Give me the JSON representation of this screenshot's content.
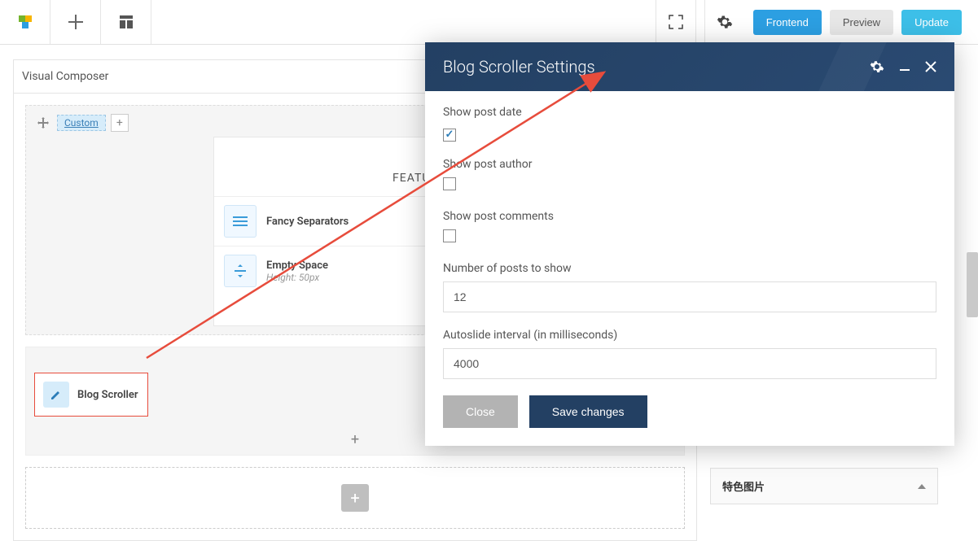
{
  "topbar": {
    "frontend_label": "Frontend",
    "preview_label": "Preview",
    "update_label": "Update"
  },
  "panel": {
    "title": "Visual Composer",
    "row_tag": "Custom"
  },
  "featured": {
    "heading": "FEATURED ARTICLES",
    "item1": {
      "title": "Fancy Separators"
    },
    "item2": {
      "title": "Empty Space",
      "sub": "Height: 50px"
    }
  },
  "blog_scroller": {
    "label": "Blog Scroller"
  },
  "modal": {
    "title": "Blog Scroller Settings",
    "fields": {
      "show_date": {
        "label": "Show post date",
        "checked": true
      },
      "show_author": {
        "label": "Show post author",
        "checked": false
      },
      "show_comments": {
        "label": "Show post comments",
        "checked": false
      },
      "num_posts": {
        "label": "Number of posts to show",
        "value": "12"
      },
      "autoslide": {
        "label": "Autoslide interval (in milliseconds)",
        "value": "4000"
      }
    },
    "close_btn": "Close",
    "save_btn": "Save changes"
  },
  "sidebar": {
    "widget_title": "特色图片"
  }
}
